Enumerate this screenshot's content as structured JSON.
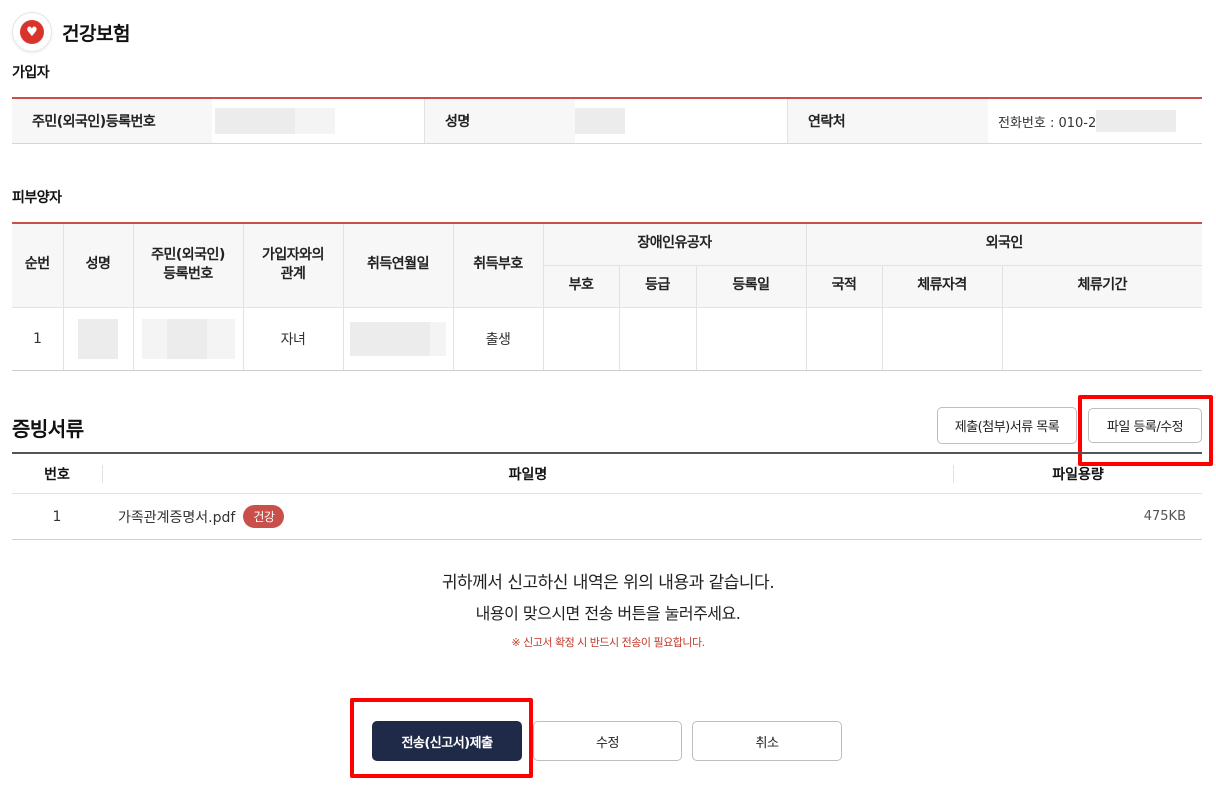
{
  "app": {
    "title": "건강보험",
    "icon": "heart-icon"
  },
  "subscriber": {
    "section_label": "가입자",
    "id_label": "주민(외국인)등록번호",
    "name_label": "성명",
    "contact_label": "연락처",
    "contact_value": "전화번호 : 010-2"
  },
  "dependents": {
    "section_label": "피부양자",
    "headers": {
      "no": "순번",
      "name": "성명",
      "id": "주민(외국인)\n등록번호",
      "relation": "가입자와의\n관계",
      "acquire_date": "취득연월일",
      "acquire_code": "취득부호",
      "disability_group": "장애인유공자",
      "disability_code": "부호",
      "disability_grade": "등급",
      "disability_date": "등록일",
      "foreigner_group": "외국인",
      "nationality": "국적",
      "stay_status": "체류자격",
      "stay_period": "체류기간"
    },
    "rows": [
      {
        "no": "1",
        "relation": "자녀",
        "acquire_code": "출생"
      }
    ]
  },
  "documents": {
    "title": "증빙서류",
    "list_button": "제출(첨부)서류 목록",
    "upload_button": "파일 등록/수정",
    "headers": {
      "no": "번호",
      "file_name": "파일명",
      "file_size": "파일용량"
    },
    "rows": [
      {
        "no": "1",
        "file_name": "가족관계증명서.pdf",
        "tag": "건강",
        "size": "475KB"
      }
    ]
  },
  "notice": {
    "line1": "귀하께서 신고하신 내역은 위의 내용과 같습니다.",
    "line2": "내용이 맞으시면 전송 버튼을 눌러주세요.",
    "warning": "※ 신고서 확정 시 반드시 전송이 필요합니다."
  },
  "actions": {
    "submit": "전송(신고서)제출",
    "edit": "수정",
    "cancel": "취소"
  },
  "colors": {
    "accent": "#c9504a",
    "primary_button": "#1f2a48",
    "highlight": "#ff0000",
    "warning_text": "#c0392b"
  }
}
